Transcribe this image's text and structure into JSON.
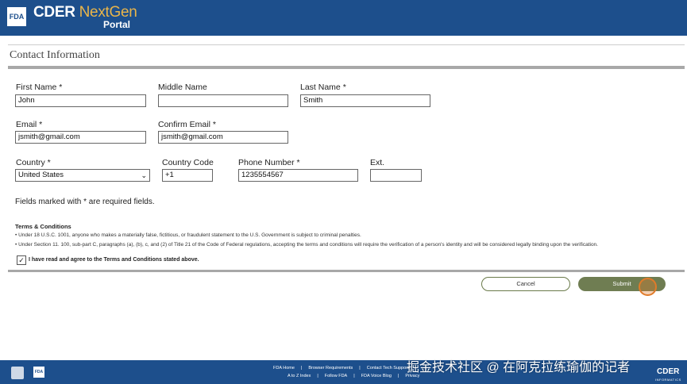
{
  "header": {
    "logo_text": "FDA",
    "brand_bold": "CDER",
    "brand_light": "NextGen",
    "brand_sub": "Portal"
  },
  "section_title": "Contact Information",
  "form": {
    "first_name_label": "First Name *",
    "first_name_value": "John",
    "middle_name_label": "Middle Name",
    "middle_name_value": "",
    "last_name_label": "Last Name *",
    "last_name_value": "Smith",
    "email_label": "Email *",
    "email_value": "jsmith@gmail.com",
    "confirm_email_label": "Confirm Email *",
    "confirm_email_value": "jsmith@gmail.com",
    "country_label": "Country *",
    "country_value": "United States",
    "country_code_label": "Country Code",
    "country_code_value": "+1",
    "phone_label": "Phone Number *",
    "phone_value": "1235554567",
    "ext_label": "Ext.",
    "ext_value": ""
  },
  "required_note": "Fields marked with * are required fields.",
  "terms": {
    "heading": "Terms & Conditions",
    "items": [
      "Under 18 U.S.C. 1001, anyone who makes a materially false, fictitious, or fraudulent statement to the U.S. Government is subject to criminal penalties.",
      "Under Section 11. 100, sub-part C, paragraphs (a), (b), c, and (2) of Title 21 of the Code of Federal regulations, accepting the terms and conditions will require the verification of a person's identity and will be considered legally binding upon the verification."
    ],
    "agree_checked": true,
    "agree_label": "I have read and agree to the Terms and Conditions stated above."
  },
  "buttons": {
    "cancel": "Cancel",
    "submit": "Submit"
  },
  "footer": {
    "row1": [
      "FDA Home",
      "|",
      "Browser Requirements",
      "|",
      "Contact Tech Support",
      "|"
    ],
    "row2": [
      "A to Z Index",
      "|",
      "Follow FDA",
      "|",
      "FDA Voice Blog",
      "|",
      "Privacy"
    ],
    "fda_icon_text": "FDA",
    "cder_logo": "CDER",
    "cder_sub": "INFORMATICS"
  },
  "watermark": "掘金技术社区 @ 在阿克拉练瑜伽的记者",
  "colors": {
    "header_bg": "#1d4f8c",
    "accent_gold": "#e9b54a",
    "submit_bg": "#6f7d52",
    "cursor": "#e07b2a"
  }
}
